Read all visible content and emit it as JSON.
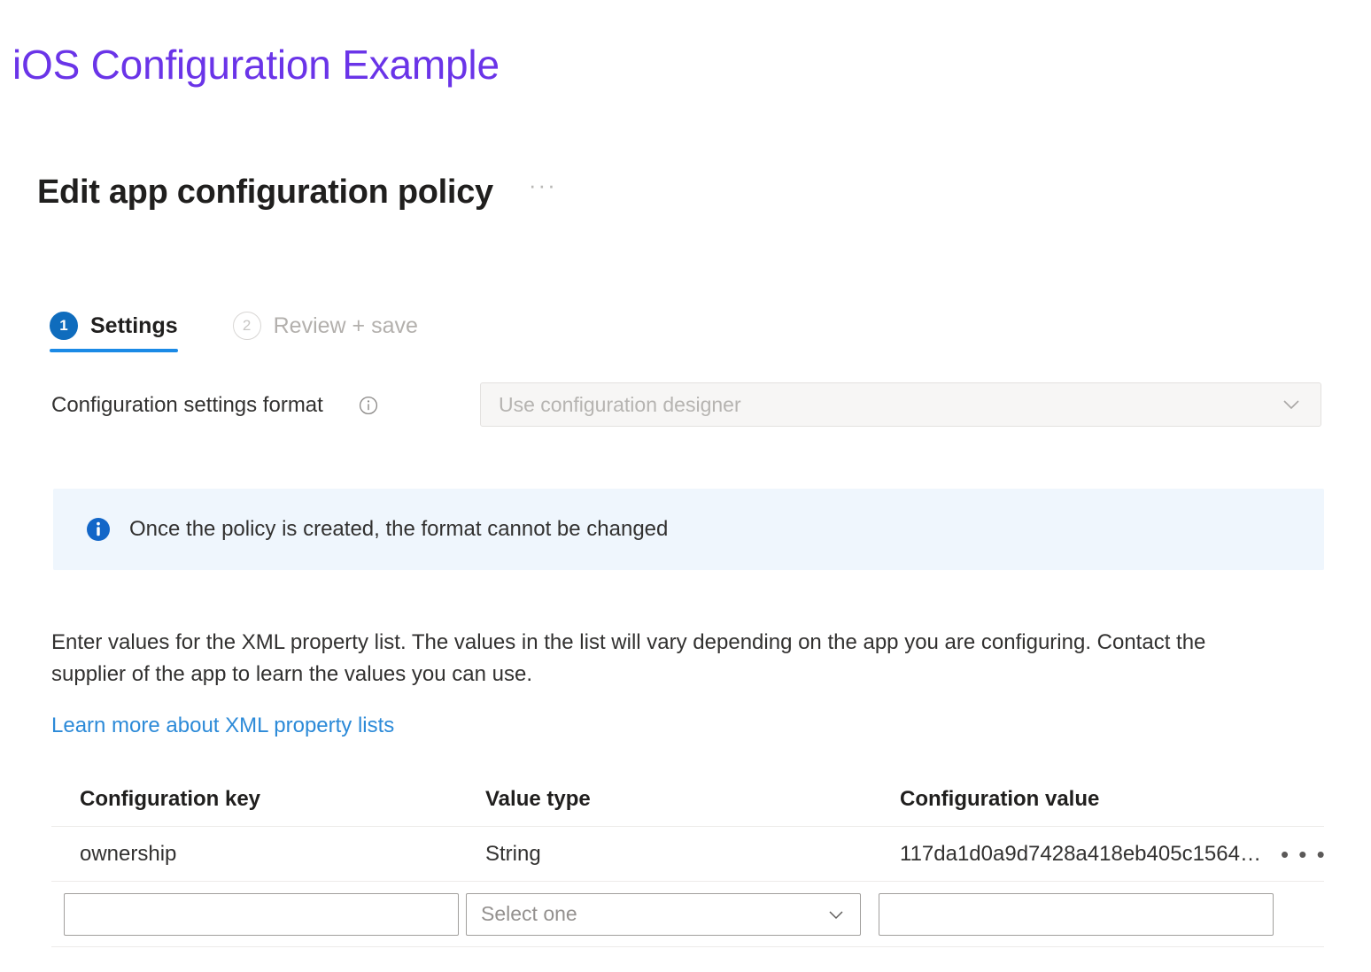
{
  "slide": {
    "title": "iOS Configuration Example",
    "title_color": "#6A34E8"
  },
  "blade": {
    "heading": "Edit app configuration policy",
    "heading_menu": "···"
  },
  "wizard": {
    "steps": [
      {
        "number": "1",
        "label": "Settings",
        "state": "active"
      },
      {
        "number": "2",
        "label": "Review + save",
        "state": "inactive"
      }
    ],
    "active_color": "#0F6CBD",
    "underline_color": "#1b8ae6"
  },
  "format": {
    "label": "Configuration settings format",
    "info_icon": "info-circle-icon",
    "dropdown_value": "Use configuration designer",
    "dropdown_disabled": true,
    "chevron_icon": "chevron-down-icon"
  },
  "banner": {
    "icon": "info-filled-icon",
    "text": "Once the policy is created, the format cannot be changed",
    "background": "#eff6fd",
    "icon_color": "#0F6CBD"
  },
  "description": {
    "paragraph": "Enter values for the XML property list. The values in the list will vary depending on the app you are configuring. Contact the supplier of the app to learn the values you can use.",
    "link_text": "Learn more about XML property lists",
    "link_color": "#2c8ad8"
  },
  "table": {
    "columns": [
      "Configuration key",
      "Value type",
      "Configuration value"
    ],
    "rows": [
      {
        "key": "ownership",
        "type": "String",
        "value": "117da1d0a9d7428a418eb405c1564…",
        "menu": "• • •"
      }
    ],
    "entry_row": {
      "key_value": "",
      "key_placeholder": "",
      "type_value": "Select one",
      "value_value": "",
      "value_placeholder": "",
      "chevron_icon": "chevron-down-icon"
    }
  }
}
